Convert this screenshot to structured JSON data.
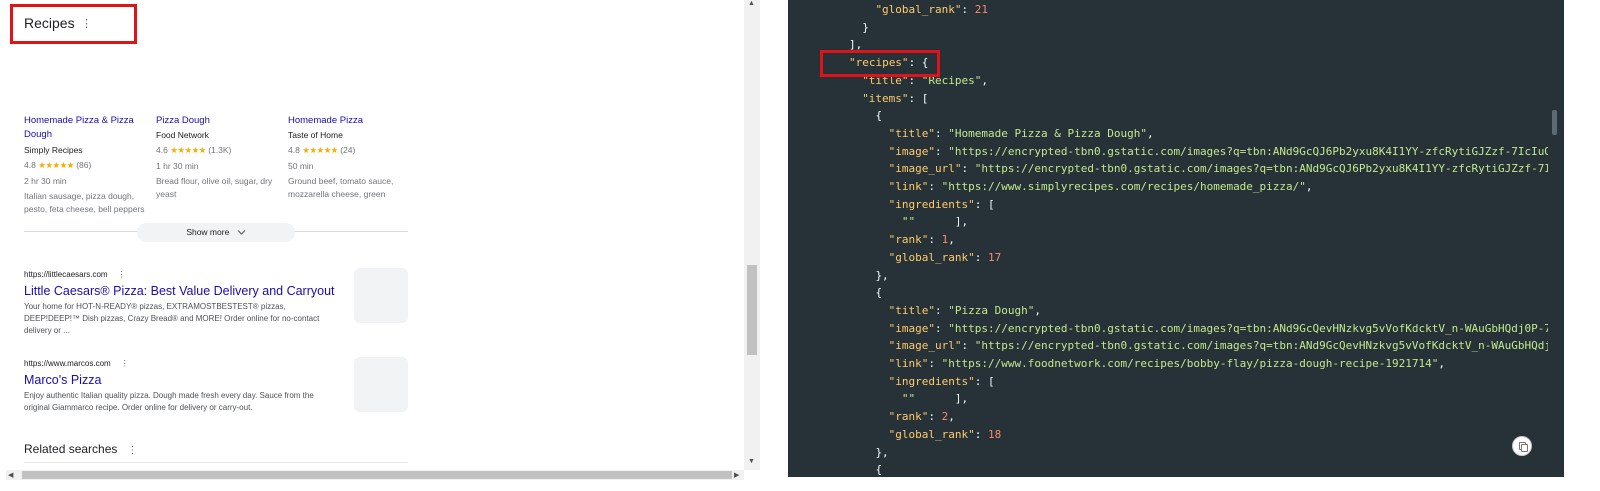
{
  "left": {
    "recipes_title": "Recipes",
    "kebab": "⋮",
    "cards": [
      {
        "title_line1": "Homemade Pizza & Pizza",
        "title_line2": "Dough",
        "source": "Simply Recipes",
        "rating": "4.8",
        "stars": "★★★★★",
        "reviews": "(86)",
        "time": "2 hr 30 min",
        "ingredients_line1": "Italian sausage, pizza dough,",
        "ingredients_line2": "pesto, feta cheese, bell peppers"
      },
      {
        "title_line1": "Pizza Dough",
        "title_line2": "",
        "source": "Food Network",
        "rating": "4.6",
        "stars": "★★★★★",
        "reviews": "(1.3K)",
        "time": "1 hr 30 min",
        "ingredients_line1": "Bread flour, olive oil, sugar, dry",
        "ingredients_line2": "yeast"
      },
      {
        "title_line1": "Homemade Pizza",
        "title_line2": "",
        "source": "Taste of Home",
        "rating": "4.8",
        "stars": "★★★★★",
        "reviews": "(24)",
        "time": "50 min",
        "ingredients_line1": "Ground beef, tomato sauce,",
        "ingredients_line2": "mozzarella cheese, green"
      }
    ],
    "show_more": "Show more",
    "results": [
      {
        "url": "https://littlecaesars.com",
        "title": "Little Caesars® Pizza: Best Value Delivery and Carryout",
        "snippet_1": "Your home for HOT-N-READY® pizzas, EXTRAMOSTBESTEST® pizzas,",
        "snippet_2": "DEEP!DEEP!™ Dish pizzas, Crazy Bread® and MORE! Order online for no-contact",
        "snippet_3": "delivery or ..."
      },
      {
        "url": "https://www.marcos.com",
        "title": "Marco's Pizza",
        "snippet_1": "Enjoy authentic Italian quality pizza. Dough made fresh every day. Sauce from the",
        "snippet_2": "original Giammarco recipe. Order online for delivery or carry-out.",
        "snippet_3": ""
      }
    ],
    "related_searches": "Related searches"
  },
  "code": {
    "lines": [
      {
        "indent": 6,
        "tokens": [
          [
            "k",
            "\"global_rank\""
          ],
          [
            "p",
            ": "
          ],
          [
            "n",
            "21"
          ]
        ]
      },
      {
        "indent": 5,
        "tokens": [
          [
            "p",
            "}"
          ]
        ]
      },
      {
        "indent": 4,
        "tokens": [
          [
            "p",
            "],"
          ]
        ]
      },
      {
        "indent": 4,
        "tokens": [
          [
            "k",
            "\"recipes\""
          ],
          [
            "p",
            ": {"
          ]
        ]
      },
      {
        "indent": 5,
        "tokens": [
          [
            "k",
            "\"title\""
          ],
          [
            "p",
            ": "
          ],
          [
            "s",
            "\"Recipes\""
          ],
          [
            "p",
            ","
          ]
        ]
      },
      {
        "indent": 5,
        "tokens": [
          [
            "k",
            "\"items\""
          ],
          [
            "p",
            ": ["
          ]
        ]
      },
      {
        "indent": 6,
        "tokens": [
          [
            "p",
            "{"
          ]
        ]
      },
      {
        "indent": 7,
        "tokens": [
          [
            "k",
            "\"title\""
          ],
          [
            "p",
            ": "
          ],
          [
            "s",
            "\"Homemade Pizza & Pizza Dough\""
          ],
          [
            "p",
            ","
          ]
        ]
      },
      {
        "indent": 7,
        "tokens": [
          [
            "k",
            "\"image\""
          ],
          [
            "p",
            ": "
          ],
          [
            "s",
            "\"https://encrypted-tbn0.gstatic.com/images?q=tbn:ANd9GcQJ6Pb2yxu8K4I1YY-zfcRytiGJZzf-7IcIuQ15Zjg"
          ]
        ]
      },
      {
        "indent": 7,
        "tokens": [
          [
            "k",
            "\"image_url\""
          ],
          [
            "p",
            ": "
          ],
          [
            "s",
            "\"https://encrypted-tbn0.gstatic.com/images?q=tbn:ANd9GcQJ6Pb2yxu8K4I1YY-zfcRytiGJZzf-7IcIuQ1"
          ]
        ]
      },
      {
        "indent": 7,
        "tokens": [
          [
            "k",
            "\"link\""
          ],
          [
            "p",
            ": "
          ],
          [
            "s",
            "\"https://www.simplyrecipes.com/recipes/homemade_pizza/\""
          ],
          [
            "p",
            ","
          ]
        ]
      },
      {
        "indent": 7,
        "tokens": [
          [
            "k",
            "\"ingredients\""
          ],
          [
            "p",
            ": ["
          ]
        ]
      },
      {
        "indent": 8,
        "tokens": [
          [
            "s",
            "\"\""
          ],
          [
            "p",
            "      ],"
          ]
        ]
      },
      {
        "indent": 7,
        "tokens": [
          [
            "k",
            "\"rank\""
          ],
          [
            "p",
            ": "
          ],
          [
            "n",
            "1"
          ],
          [
            "p",
            ","
          ]
        ]
      },
      {
        "indent": 7,
        "tokens": [
          [
            "k",
            "\"global_rank\""
          ],
          [
            "p",
            ": "
          ],
          [
            "n",
            "17"
          ]
        ]
      },
      {
        "indent": 6,
        "tokens": [
          [
            "p",
            "},"
          ]
        ]
      },
      {
        "indent": 6,
        "tokens": [
          [
            "p",
            "{"
          ]
        ]
      },
      {
        "indent": 7,
        "tokens": [
          [
            "k",
            "\"title\""
          ],
          [
            "p",
            ": "
          ],
          [
            "s",
            "\"Pizza Dough\""
          ],
          [
            "p",
            ","
          ]
        ]
      },
      {
        "indent": 7,
        "tokens": [
          [
            "k",
            "\"image\""
          ],
          [
            "p",
            ": "
          ],
          [
            "s",
            "\"https://encrypted-tbn0.gstatic.com/images?q=tbn:ANd9GcQevHNzkvg5vVofKdcktV_n-WAuGbHQdj0P-74sudl"
          ]
        ]
      },
      {
        "indent": 7,
        "tokens": [
          [
            "k",
            "\"image_url\""
          ],
          [
            "p",
            ": "
          ],
          [
            "s",
            "\"https://encrypted-tbn0.gstatic.com/images?q=tbn:ANd9GcQevHNzkvg5vVofKdcktV_n-WAuGbHQdj0P-7"
          ]
        ]
      },
      {
        "indent": 7,
        "tokens": [
          [
            "k",
            "\"link\""
          ],
          [
            "p",
            ": "
          ],
          [
            "s",
            "\"https://www.foodnetwork.com/recipes/bobby-flay/pizza-dough-recipe-1921714\""
          ],
          [
            "p",
            ","
          ]
        ]
      },
      {
        "indent": 7,
        "tokens": [
          [
            "k",
            "\"ingredients\""
          ],
          [
            "p",
            ": ["
          ]
        ]
      },
      {
        "indent": 8,
        "tokens": [
          [
            "s",
            "\"\""
          ],
          [
            "p",
            "      ],"
          ]
        ]
      },
      {
        "indent": 7,
        "tokens": [
          [
            "k",
            "\"rank\""
          ],
          [
            "p",
            ": "
          ],
          [
            "n",
            "2"
          ],
          [
            "p",
            ","
          ]
        ]
      },
      {
        "indent": 7,
        "tokens": [
          [
            "k",
            "\"global_rank\""
          ],
          [
            "p",
            ": "
          ],
          [
            "n",
            "18"
          ]
        ]
      },
      {
        "indent": 6,
        "tokens": [
          [
            "p",
            "},"
          ]
        ]
      },
      {
        "indent": 6,
        "tokens": [
          [
            "p",
            "{"
          ]
        ]
      }
    ]
  },
  "colors": {
    "code_bg": "#263238",
    "key": "#ffcb6b",
    "string": "#c3e88d",
    "number": "#f78c6c",
    "highlight_box": "#e0131a",
    "link": "#1a0dab"
  },
  "icons": {
    "copy": "copy-icon",
    "chevron": "chevron-down-icon"
  }
}
